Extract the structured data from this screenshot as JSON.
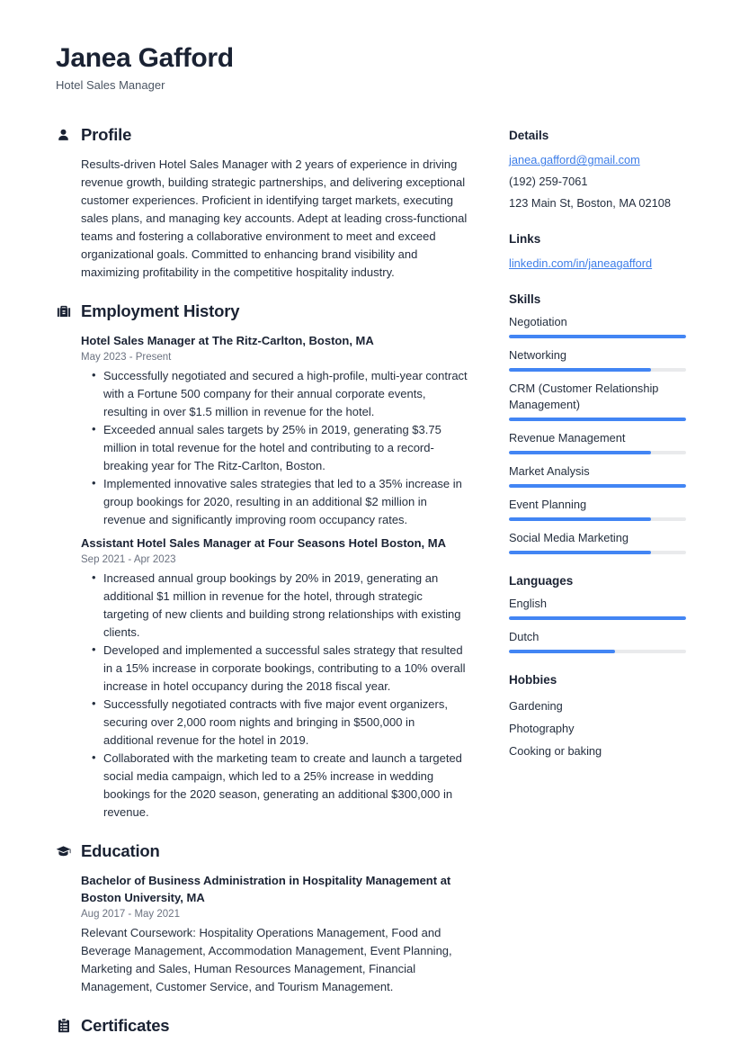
{
  "header": {
    "name": "Janea Gafford",
    "title": "Hotel Sales Manager"
  },
  "theme": {
    "accent": "#4285f4",
    "link": "#3d7de8",
    "heading": "#1a2233",
    "text": "#252f3f",
    "muted": "#6b7280",
    "track": "#e9eaec"
  },
  "sections": {
    "profile": {
      "title": "Profile",
      "icon": "user-icon",
      "text": "Results-driven Hotel Sales Manager with 2 years of experience in driving revenue growth, building strategic partnerships, and delivering exceptional customer experiences. Proficient in identifying target markets, executing sales plans, and managing key accounts. Adept at leading cross-functional teams and fostering a collaborative environment to meet and exceed organizational goals. Committed to enhancing brand visibility and maximizing profitability in the competitive hospitality industry."
    },
    "employment": {
      "title": "Employment History",
      "icon": "briefcase-icon",
      "entries": [
        {
          "title": "Hotel Sales Manager at The Ritz-Carlton, Boston, MA",
          "date": "May 2023 - Present",
          "bullets": [
            "Successfully negotiated and secured a high-profile, multi-year contract with a Fortune 500 company for their annual corporate events, resulting in over $1.5 million in revenue for the hotel.",
            "Exceeded annual sales targets by 25% in 2019, generating $3.75 million in total revenue for the hotel and contributing to a record-breaking year for The Ritz-Carlton, Boston.",
            "Implemented innovative sales strategies that led to a 35% increase in group bookings for 2020, resulting in an additional $2 million in revenue and significantly improving room occupancy rates."
          ]
        },
        {
          "title": "Assistant Hotel Sales Manager at Four Seasons Hotel Boston, MA",
          "date": "Sep 2021 - Apr 2023",
          "bullets": [
            "Increased annual group bookings by 20% in 2019, generating an additional $1 million in revenue for the hotel, through strategic targeting of new clients and building strong relationships with existing clients.",
            "Developed and implemented a successful sales strategy that resulted in a 15% increase in corporate bookings, contributing to a 10% overall increase in hotel occupancy during the 2018 fiscal year.",
            "Successfully negotiated contracts with five major event organizers, securing over 2,000 room nights and bringing in $500,000 in additional revenue for the hotel in 2019.",
            "Collaborated with the marketing team to create and launch a targeted social media campaign, which led to a 25% increase in wedding bookings for the 2020 season, generating an additional $300,000 in revenue."
          ]
        }
      ]
    },
    "education": {
      "title": "Education",
      "icon": "graduation-cap-icon",
      "entries": [
        {
          "title": "Bachelor of Business Administration in Hospitality Management at Boston University, MA",
          "date": "Aug 2017 - May 2021",
          "description": "Relevant Coursework: Hospitality Operations Management, Food and Beverage Management, Accommodation Management, Event Planning, Marketing and Sales, Human Resources Management, Financial Management, Customer Service, and Tourism Management."
        }
      ]
    },
    "certificates": {
      "title": "Certificates",
      "icon": "clipboard-icon"
    }
  },
  "sidebar": {
    "details": {
      "title": "Details",
      "email": "janea.gafford@gmail.com",
      "phone": "(192) 259-7061",
      "address": "123 Main St, Boston, MA 02108"
    },
    "links": {
      "title": "Links",
      "items": [
        {
          "label": "linkedin.com/in/janeagafford"
        }
      ]
    },
    "skills": {
      "title": "Skills",
      "items": [
        {
          "label": "Negotiation",
          "level": 100
        },
        {
          "label": "Networking",
          "level": 80
        },
        {
          "label": "CRM (Customer Relationship Management)",
          "level": 100
        },
        {
          "label": "Revenue Management",
          "level": 80
        },
        {
          "label": "Market Analysis",
          "level": 100
        },
        {
          "label": "Event Planning",
          "level": 80
        },
        {
          "label": "Social Media Marketing",
          "level": 80
        }
      ]
    },
    "languages": {
      "title": "Languages",
      "items": [
        {
          "label": "English",
          "level": 100
        },
        {
          "label": "Dutch",
          "level": 60
        }
      ]
    },
    "hobbies": {
      "title": "Hobbies",
      "items": [
        {
          "label": "Gardening"
        },
        {
          "label": "Photography"
        },
        {
          "label": "Cooking or baking"
        }
      ]
    }
  }
}
